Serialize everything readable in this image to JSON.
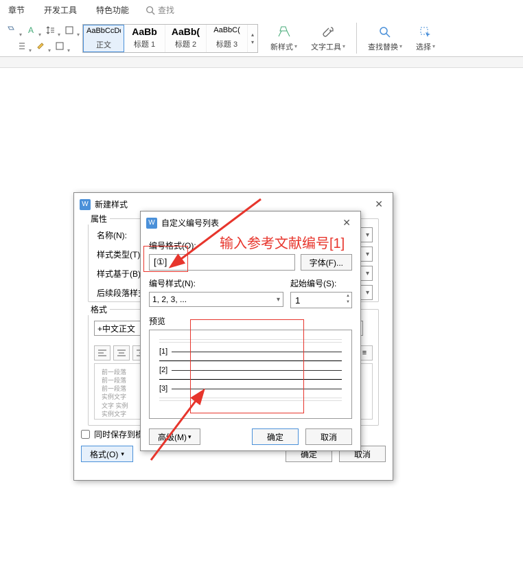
{
  "ribbon": {
    "tabs": [
      "章节",
      "开发工具",
      "特色功能"
    ],
    "search_placeholder": "查找",
    "styles": [
      {
        "preview": "AaBbCcDd",
        "name": "正文",
        "selected": true,
        "bold": false
      },
      {
        "preview": "AaBb",
        "name": "标题 1",
        "bold": true
      },
      {
        "preview": "AaBb(",
        "name": "标题 2",
        "bold": true
      },
      {
        "preview": "AaBbC(",
        "name": "标题 3",
        "bold": false
      }
    ],
    "big_buttons": [
      {
        "label": "新样式",
        "dd": true
      },
      {
        "label": "文字工具",
        "dd": true
      },
      {
        "label": "查找替换",
        "dd": true
      },
      {
        "label": "选择",
        "dd": true
      }
    ]
  },
  "dlg_newstyle": {
    "title": "新建样式",
    "section_props": "属性",
    "section_format": "格式",
    "name_label": "名称(N):",
    "type_label": "样式类型(T):",
    "based_label": "样式基于(B):",
    "following_label": "后续段落样式",
    "font_value": "+中文正文",
    "preview_lines": [
      "前一段落",
      "前一段落",
      "前一段落",
      "实例文字",
      "文字 实例",
      "实例文字"
    ],
    "save_checkbox": "同时保存到模",
    "format_btn": "格式(O)",
    "ok": "确定",
    "cancel": "取消"
  },
  "dlg_numlist": {
    "title": "自定义编号列表",
    "format_label": "编号格式(O):",
    "format_value": "[①]",
    "font_btn": "字体(F)...",
    "style_label": "编号样式(N):",
    "style_value": "1, 2, 3, ...",
    "start_label": "起始编号(S):",
    "start_value": "1",
    "preview_label": "预览",
    "preview_items": [
      "[1]",
      "[2]",
      "[3]"
    ],
    "advanced_btn": "高级(M)",
    "ok": "确定",
    "cancel": "取消"
  },
  "annotation": {
    "text": "输入参考文献编号[1]"
  }
}
